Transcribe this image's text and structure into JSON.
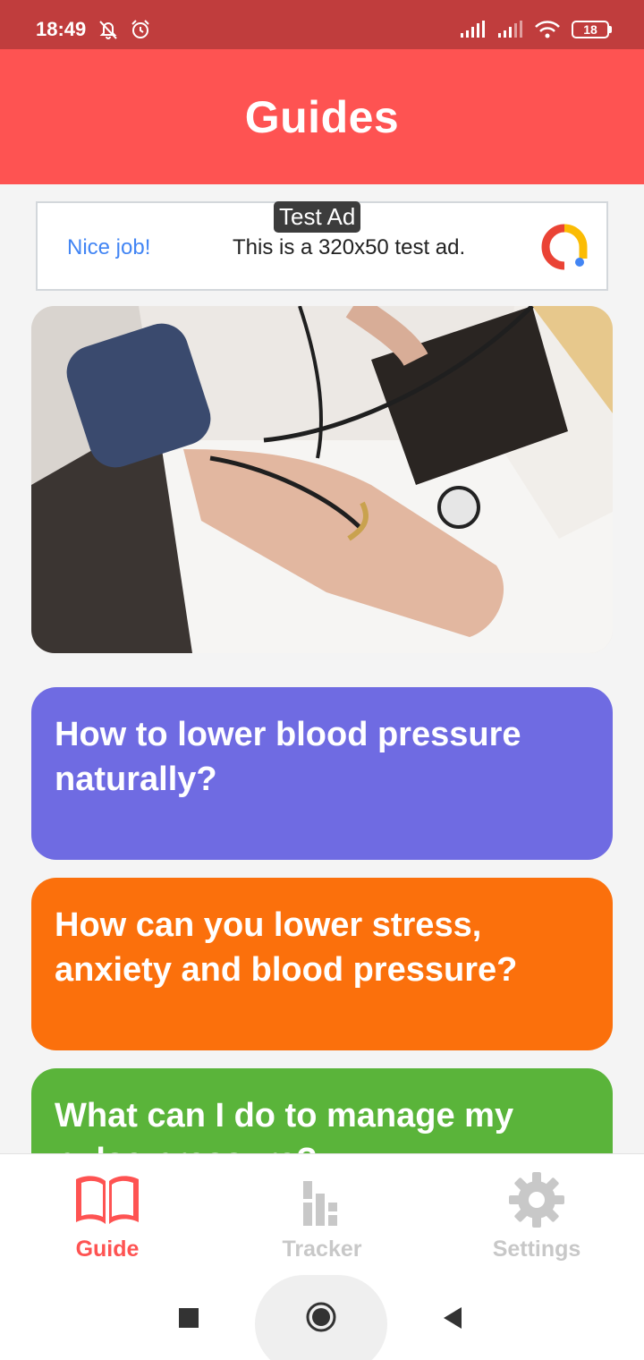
{
  "status_bar": {
    "time": "18:49",
    "battery": "18",
    "background_color": "#c03d3d"
  },
  "header": {
    "title": "Guides",
    "background_color": "#fe5352"
  },
  "ad": {
    "tag": "Test Ad",
    "left_text": "Nice job!",
    "body_text": "This is a 320x50 test ad."
  },
  "hero": {
    "icon": "blood-pressure-photo"
  },
  "guides": [
    {
      "title": "How to lower blood pressure naturally?",
      "color": "#6f6be2"
    },
    {
      "title": "How can you lower stress, anxiety and blood pressure?",
      "color": "#fb700c"
    },
    {
      "title": "What can I do to manage my pulse pressure?",
      "color": "#5ab43a"
    }
  ],
  "bottom_nav": {
    "active_color": "#fe5352",
    "inactive_color": "#c8c8c8",
    "items": [
      {
        "label": "Guide",
        "icon": "book-icon",
        "active": true
      },
      {
        "label": "Tracker",
        "icon": "chart-icon",
        "active": false
      },
      {
        "label": "Settings",
        "icon": "gear-icon",
        "active": false
      }
    ]
  },
  "system_nav": {
    "icons": [
      "recents-square-icon",
      "home-circle-icon",
      "back-triangle-icon"
    ]
  }
}
